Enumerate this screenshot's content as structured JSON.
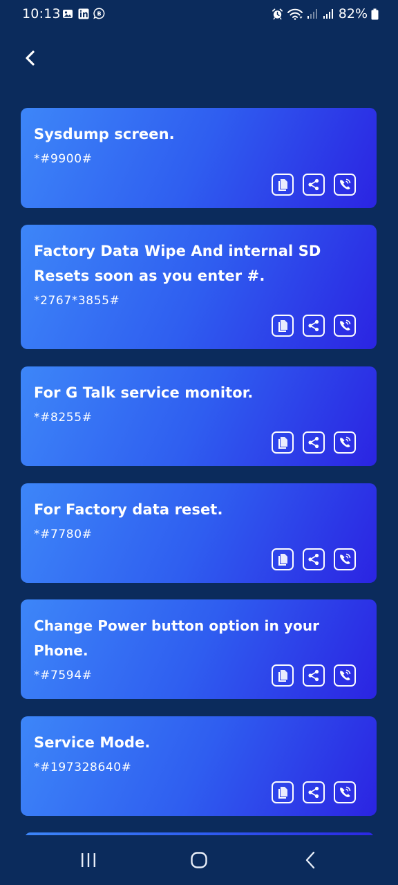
{
  "status_bar": {
    "time": "10:13",
    "battery_text": "82%",
    "left_icons": [
      "gallery-icon",
      "linkedin-icon",
      "business-chat-icon"
    ],
    "right_icons": [
      "alarm-icon",
      "wifi-icon",
      "signal-icon",
      "signal-icon",
      "battery-icon"
    ]
  },
  "header": {
    "back_icon": "chevron-left-icon"
  },
  "cards": [
    {
      "title": "Sysdump screen.",
      "code": "*#9900#"
    },
    {
      "title": "Factory Data Wipe And internal SD Resets soon as you enter #.",
      "code": "*2767*3855#"
    },
    {
      "title": "For G Talk service monitor.",
      "code": "*#8255#"
    },
    {
      "title": "For Factory data reset.",
      "code": "*#7780#"
    },
    {
      "title": "Change Power button option in your Phone.",
      "code": "*#7594#"
    },
    {
      "title": "Service Mode.",
      "code": "*#197328640#"
    }
  ],
  "card_actions": [
    "copy-icon",
    "share-icon",
    "call-icon"
  ],
  "nav_bar": [
    "recent-apps-icon",
    "home-icon",
    "back-icon"
  ],
  "colors": {
    "background": "#0b2b5c",
    "card_gradient_start": "#3d86f8",
    "card_gradient_end": "#2b24e2",
    "text": "#ffffff"
  }
}
